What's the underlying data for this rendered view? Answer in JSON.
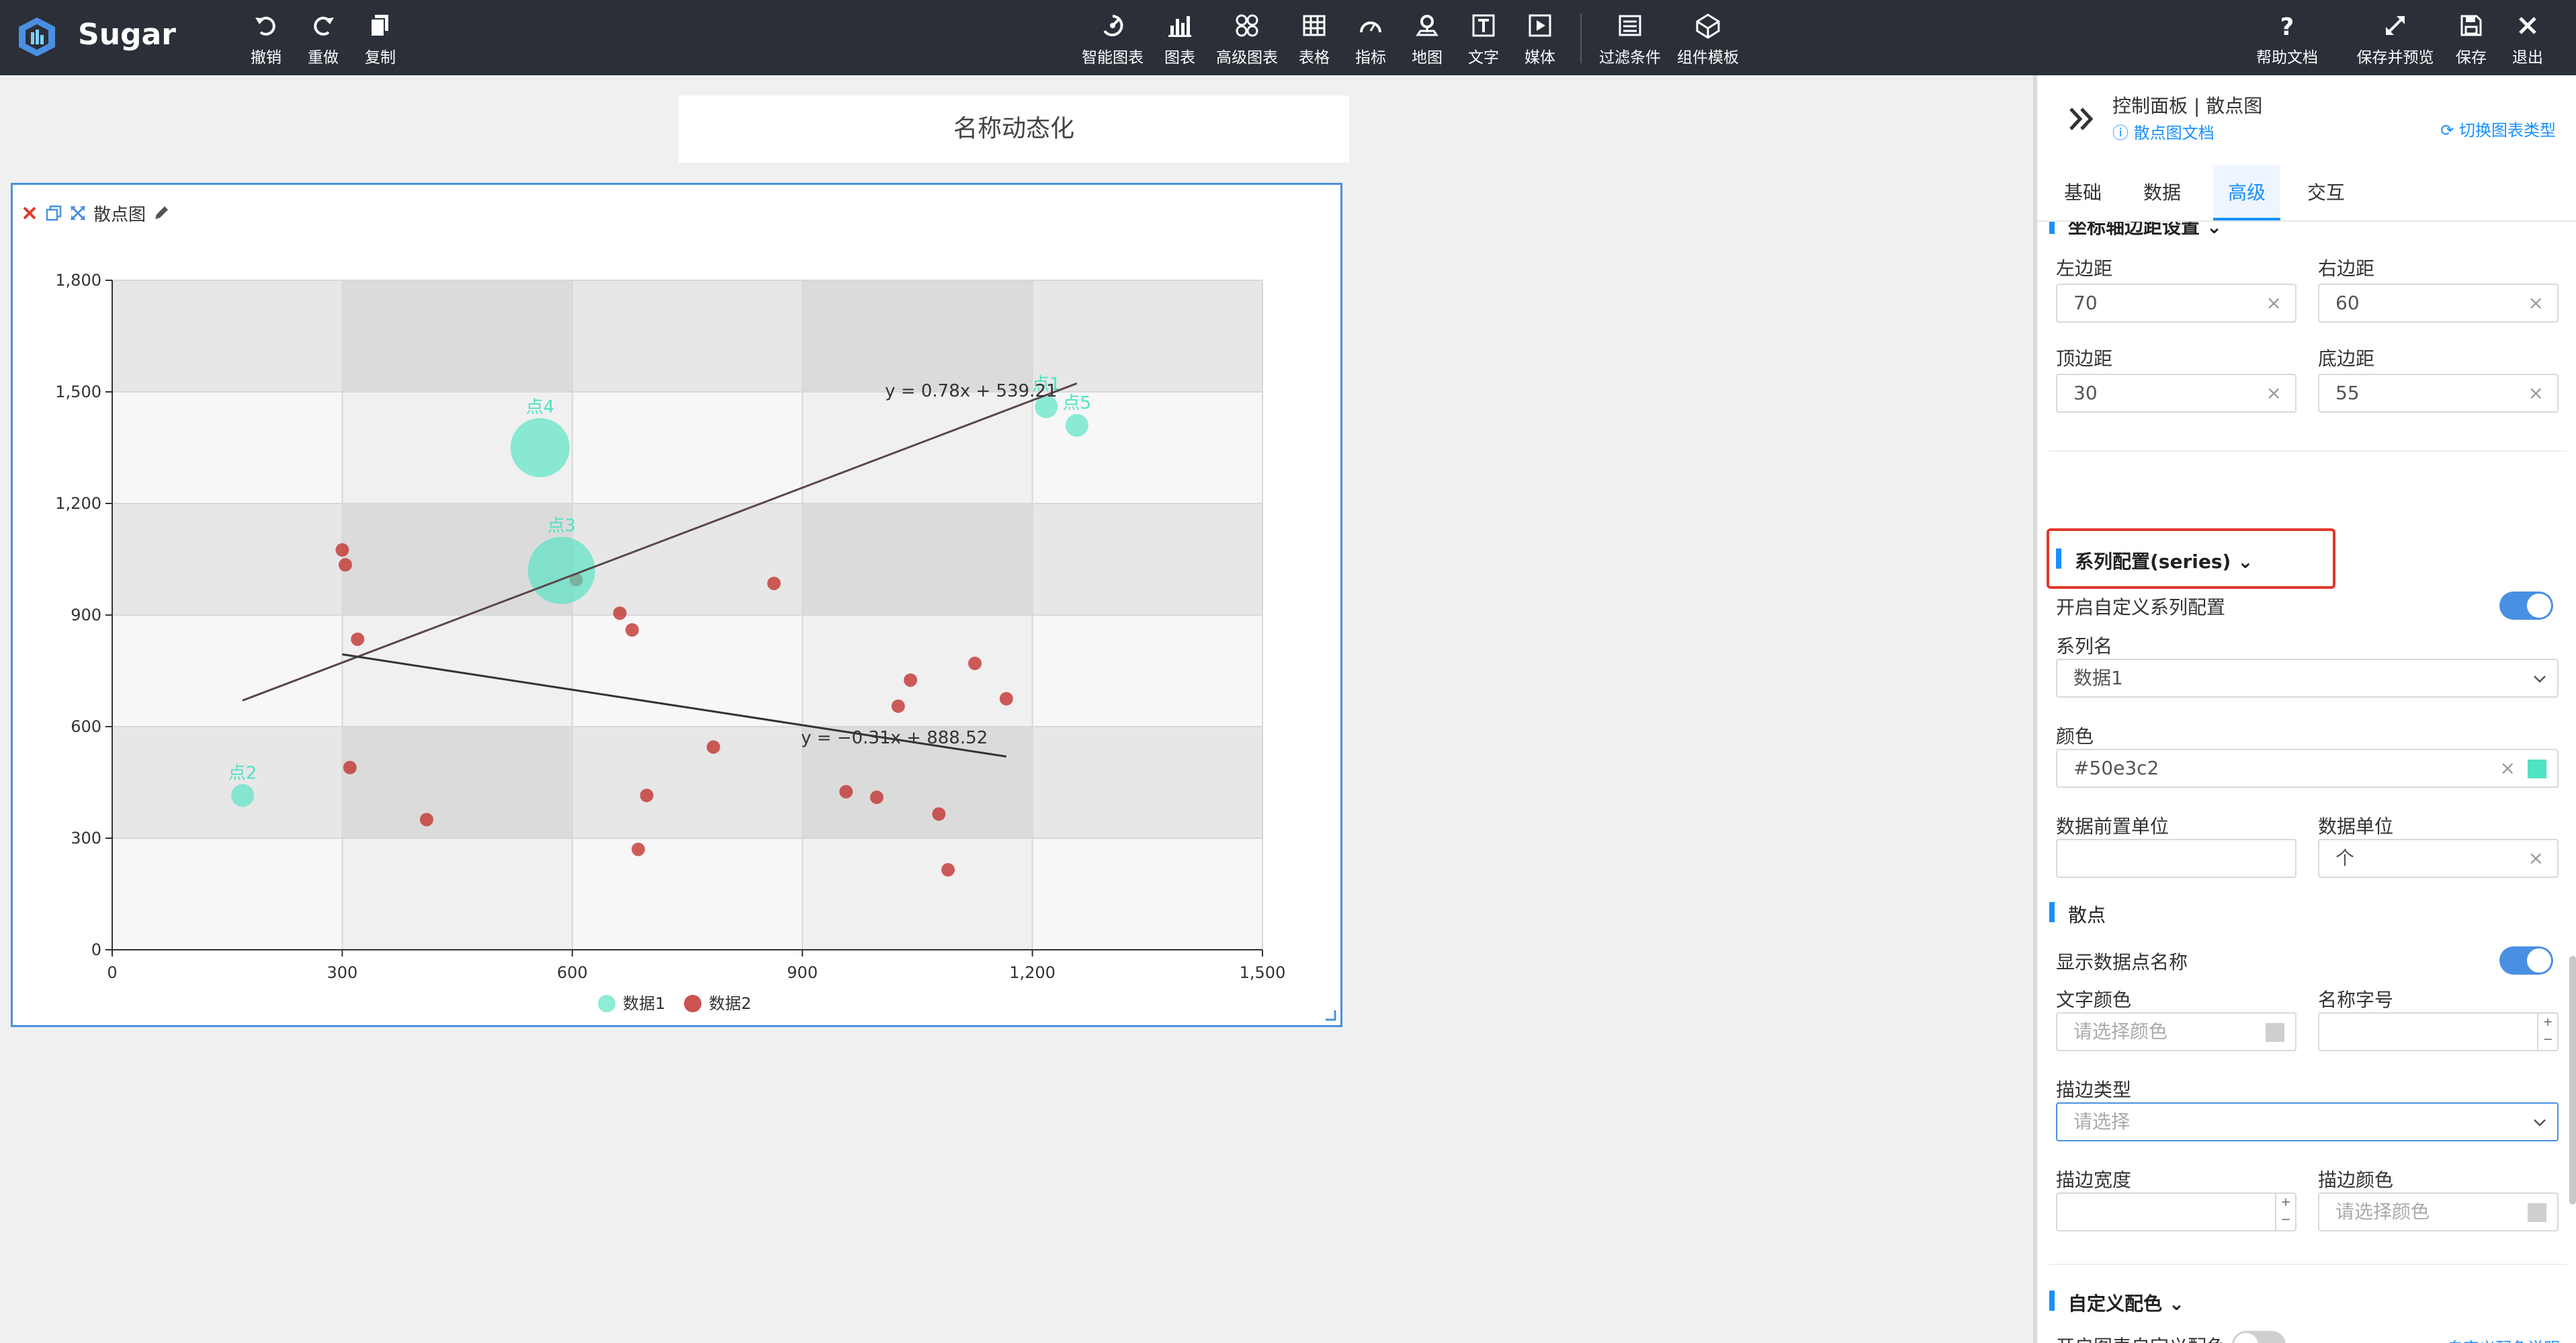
{
  "app": {
    "name": "Sugar"
  },
  "toolbar": {
    "left": [
      {
        "label": "撤销",
        "icon": "undo-icon"
      },
      {
        "label": "重做",
        "icon": "redo-icon"
      },
      {
        "label": "复制",
        "icon": "copy-icon"
      }
    ],
    "center": [
      {
        "label": "智能图表",
        "icon": "smart-chart-icon"
      },
      {
        "label": "图表",
        "icon": "bar-chart-icon"
      },
      {
        "label": "高级图表",
        "icon": "advanced-chart-icon"
      },
      {
        "label": "表格",
        "icon": "table-icon"
      },
      {
        "label": "指标",
        "icon": "gauge-icon"
      },
      {
        "label": "地图",
        "icon": "map-pin-icon"
      },
      {
        "label": "文字",
        "icon": "text-icon"
      },
      {
        "label": "媒体",
        "icon": "media-icon"
      },
      {
        "label": "过滤条件",
        "icon": "filter-icon"
      },
      {
        "label": "组件模板",
        "icon": "template-icon"
      }
    ],
    "right": [
      {
        "label": "帮助文档",
        "icon": "help-icon"
      },
      {
        "label": "保存并预览",
        "icon": "expand-icon"
      },
      {
        "label": "保存",
        "icon": "save-icon"
      },
      {
        "label": "退出",
        "icon": "close-icon"
      }
    ]
  },
  "canvas": {
    "title": "名称动态化",
    "chart_label": "散点图"
  },
  "chart_data": {
    "type": "scatter",
    "xlim": [
      0,
      1500
    ],
    "ylim": [
      0,
      1800
    ],
    "x_ticks": [
      "0",
      "300",
      "600",
      "900",
      "1,200",
      "1,500"
    ],
    "y_ticks": [
      "0",
      "300",
      "600",
      "900",
      "1,200",
      "1,500",
      "1,800"
    ],
    "legend": [
      "数据1",
      "数据2"
    ],
    "legend_position": "bottom",
    "series": [
      {
        "name": "数据1",
        "color": "#50e3c2",
        "points": [
          {
            "name": "点1",
            "x": 1218,
            "y": 1460,
            "size": 1
          },
          {
            "name": "点5",
            "x": 1258,
            "y": 1410,
            "size": 1
          },
          {
            "name": "点4",
            "x": 558,
            "y": 1350,
            "size": 3
          },
          {
            "name": "点3",
            "x": 586,
            "y": 1020,
            "size": 4
          },
          {
            "name": "点2",
            "x": 170,
            "y": 415,
            "size": 1
          }
        ],
        "trendline": {
          "label": "y = 0.78x + 539.21",
          "x": [
            170,
            1258
          ]
        }
      },
      {
        "name": "数据2",
        "color": "#c23531",
        "points": [
          {
            "x": 300,
            "y": 1075
          },
          {
            "x": 304,
            "y": 1035
          },
          {
            "x": 320,
            "y": 835
          },
          {
            "x": 310,
            "y": 490
          },
          {
            "x": 410,
            "y": 350
          },
          {
            "x": 605,
            "y": 995
          },
          {
            "x": 662,
            "y": 905
          },
          {
            "x": 678,
            "y": 860
          },
          {
            "x": 686,
            "y": 270
          },
          {
            "x": 697,
            "y": 415
          },
          {
            "x": 784,
            "y": 545
          },
          {
            "x": 863,
            "y": 985
          },
          {
            "x": 957,
            "y": 425
          },
          {
            "x": 997,
            "y": 410
          },
          {
            "x": 1025,
            "y": 655
          },
          {
            "x": 1041,
            "y": 725
          },
          {
            "x": 1078,
            "y": 365
          },
          {
            "x": 1090,
            "y": 215
          },
          {
            "x": 1125,
            "y": 770
          },
          {
            "x": 1166,
            "y": 675
          }
        ],
        "trendline": {
          "label": "y = −0.31x + 888.52",
          "x": [
            300,
            1166
          ]
        }
      }
    ]
  },
  "panel": {
    "title": "控制面板 | 散点图",
    "doc_link": "散点图文档",
    "switch_link": "切换图表类型",
    "tabs": [
      "基础",
      "数据",
      "高级",
      "交互"
    ],
    "active_tab": "高级",
    "axis_section": "坐标轴边距设置",
    "left_margin_label": "左边距",
    "left_margin": "70",
    "right_margin_label": "右边距",
    "right_margin": "60",
    "top_margin_label": "顶边距",
    "top_margin": "30",
    "bottom_margin_label": "底边距",
    "bottom_margin": "55",
    "series_section": "系列配置(series)",
    "custom_series_label": "开启自定义系列配置",
    "custom_series_on": true,
    "series_name_label": "系列名",
    "series_name_value": "数据1",
    "color_label": "颜色",
    "color_value": "#50e3c2",
    "prefix_unit_label": "数据前置单位",
    "prefix_unit_value": "",
    "unit_label": "数据单位",
    "unit_value": "个",
    "scatter_section": "散点",
    "show_name_label": "显示数据点名称",
    "show_name_on": true,
    "text_color_label": "文字颜色",
    "text_color_placeholder": "请选择颜色",
    "name_font_label": "名称字号",
    "stroke_type_label": "描边类型",
    "stroke_type_placeholder": "请选择",
    "stroke_width_label": "描边宽度",
    "stroke_color_label": "描边颜色",
    "stroke_color_placeholder": "请选择颜色",
    "custom_color_section": "自定义配色",
    "custom_color_label": "开启图表自定义配色",
    "custom_color_on": false,
    "custom_color_link": "自定义配色说明"
  },
  "colors": {
    "accent": "#1890ff",
    "toggle_on": "#4a90e2",
    "highlight": "#e0392b"
  }
}
